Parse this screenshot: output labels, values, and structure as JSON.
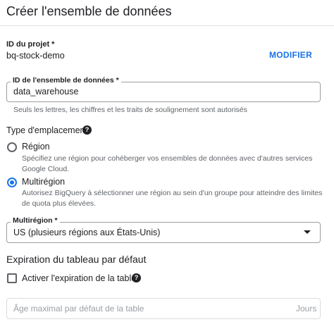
{
  "header": {
    "title": "Créer l'ensemble de données"
  },
  "project": {
    "label": "ID du projet *",
    "value": "bq-stock-demo",
    "modify_label": "MODIFIER"
  },
  "dataset": {
    "label": "ID de l'ensemble de données *",
    "value": "data_warehouse",
    "hint": "Seuls les lettres, les chiffres et les traits de soulignement sont autorisés"
  },
  "location": {
    "title": "Type d'emplacement",
    "help_icon": "help-icon",
    "options": [
      {
        "label": "Région",
        "description": "Spécifiez une région pour cohéberger vos ensembles de données avec d'autres services Google Cloud.",
        "selected": false
      },
      {
        "label": "Multirégion",
        "description": "Autorisez BigQuery à sélectionner une région au sein d'un groupe pour atteindre des limites de quota plus élevées.",
        "selected": true
      }
    ]
  },
  "multiregion": {
    "label": "Multirégion *",
    "value": "US (plusieurs régions aux États-Unis)"
  },
  "expiration": {
    "title": "Expiration du tableau par défaut",
    "checkbox_label": "Activer l'expiration de la table",
    "checked": false,
    "age_placeholder": "Âge maximal par défaut de la table",
    "age_suffix": "Jours"
  },
  "colors": {
    "accent": "#1a73e8",
    "text": "#202124",
    "secondary_text": "#5f6368"
  }
}
